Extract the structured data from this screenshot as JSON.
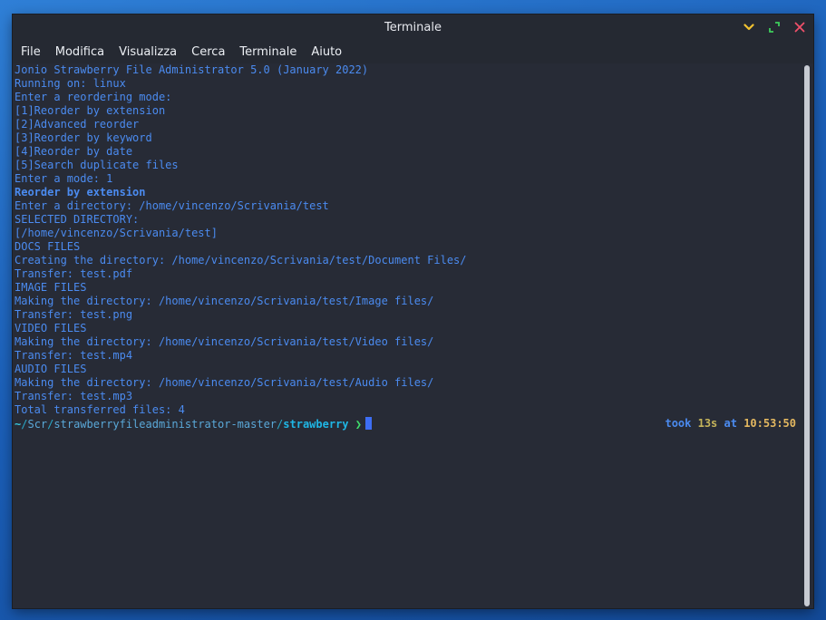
{
  "window": {
    "title": "Terminale"
  },
  "menu": [
    "File",
    "Modifica",
    "Visualizza",
    "Cerca",
    "Terminale",
    "Aiuto"
  ],
  "terminal": {
    "lines": [
      {
        "text": "Jonio Strawberry File Administrator 5.0 (January 2022)",
        "bold": false
      },
      {
        "text": "Running on: linux",
        "bold": false
      },
      {
        "text": "Enter a reordering mode:",
        "bold": false
      },
      {
        "text": "[1]Reorder by extension",
        "bold": false
      },
      {
        "text": "[2]Advanced reorder",
        "bold": false
      },
      {
        "text": "[3]Reorder by keyword",
        "bold": false
      },
      {
        "text": "[4]Reorder by date",
        "bold": false
      },
      {
        "text": "[5]Search duplicate files",
        "bold": false
      },
      {
        "text": "Enter a mode: 1",
        "bold": false
      },
      {
        "text": "Reorder by extension",
        "bold": true
      },
      {
        "text": "Enter a directory: /home/vincenzo/Scrivania/test",
        "bold": false
      },
      {
        "text": "SELECTED DIRECTORY:",
        "bold": false
      },
      {
        "text": "[/home/vincenzo/Scrivania/test]",
        "bold": false
      },
      {
        "text": "DOCS FILES",
        "bold": false
      },
      {
        "text": "Creating the directory: /home/vincenzo/Scrivania/test/Document Files/",
        "bold": false
      },
      {
        "text": "Transfer: test.pdf",
        "bold": false
      },
      {
        "text": "IMAGE FILES",
        "bold": false
      },
      {
        "text": "Making the directory: /home/vincenzo/Scrivania/test/Image files/",
        "bold": false
      },
      {
        "text": "Transfer: test.png",
        "bold": false
      },
      {
        "text": "VIDEO FILES",
        "bold": false
      },
      {
        "text": "Making the directory: /home/vincenzo/Scrivania/test/Video files/",
        "bold": false
      },
      {
        "text": "Transfer: test.mp4",
        "bold": false
      },
      {
        "text": "AUDIO FILES",
        "bold": false
      },
      {
        "text": "Making the directory: /home/vincenzo/Scrivania/test/Audio files/",
        "bold": false
      },
      {
        "text": "Transfer: test.mp3",
        "bold": false
      },
      {
        "text": "Total transferred files: 4",
        "bold": false
      }
    ],
    "prompt": {
      "tilde": "~",
      "sep1": "/",
      "seg1": "Scr",
      "sep2": "/",
      "seg2": "strawberryfileadministrator-master",
      "sep3": "/",
      "current": "strawberry",
      "arrow": " ❯",
      "took_label": "took ",
      "duration": "13s",
      "at_label": " at ",
      "time": "10:53:50"
    }
  },
  "colors": {
    "text": "#4b8bf0",
    "background": "#272b36",
    "cursor": "#3d6ef5",
    "arrow": "#3fe06c"
  },
  "icons": {
    "minimize": "chevron-down-icon",
    "maximize": "maximize-arrows-icon",
    "close": "close-icon"
  }
}
